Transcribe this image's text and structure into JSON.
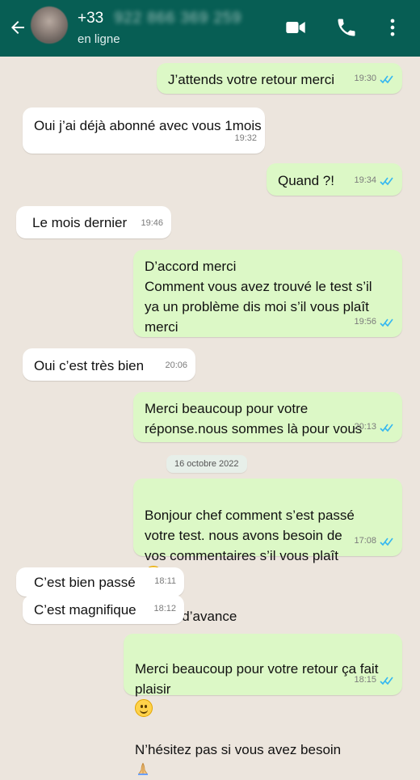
{
  "header": {
    "prefix": "+33",
    "blurred_number": "922 866 369 259",
    "status": "en ligne",
    "icons": [
      "back-arrow-icon",
      "video-call-icon",
      "phone-icon",
      "more-vert-icon"
    ]
  },
  "date_chip": "16 octobre 2022",
  "messages": [
    {
      "dir": "out",
      "text": "J’attends votre retour merci",
      "time": "19:30"
    },
    {
      "dir": "in",
      "text": "Oui j’ai déjà abonné avec vous 1mois",
      "time": "19:32"
    },
    {
      "dir": "out",
      "text": "Quand ?!",
      "time": "19:34"
    },
    {
      "dir": "in",
      "text": "Le mois dernier",
      "time": "19:46"
    },
    {
      "dir": "out",
      "text": "D’accord merci\nComment vous avez trouvé le test s’il\nya un problème dis moi s’il vous plaît\nmerci",
      "time": "19:56"
    },
    {
      "dir": "in",
      "text": "Oui c’est très bien",
      "time": "20:06"
    },
    {
      "dir": "out",
      "text": "Merci beaucoup pour votre\nréponse.nous sommes là pour vous",
      "time": "20:13"
    },
    {
      "dir": "out",
      "text1": "Bonjour chef comment s’est passé\nvotre test. nous avons besoin de\nvos commentaires s’il vous plaît",
      "text2": "merci d’avance",
      "time": "17:08"
    },
    {
      "dir": "in",
      "text": "C’est bien passé",
      "time": "18:11"
    },
    {
      "dir": "in",
      "text": "C’est magnifique",
      "time": "18:12"
    },
    {
      "dir": "out",
      "text1": "Merci beaucoup pour votre retour ça fait\nplaisir",
      "text2": "N’hésitez pas si vous avez besoin",
      "time": "18:15"
    }
  ],
  "colors": {
    "header": "#075e54",
    "chat_bg": "#ece5dd",
    "out_bubble": "#dcf8c6",
    "in_bubble": "#ffffff",
    "read_ticks": "#34b7f1"
  }
}
